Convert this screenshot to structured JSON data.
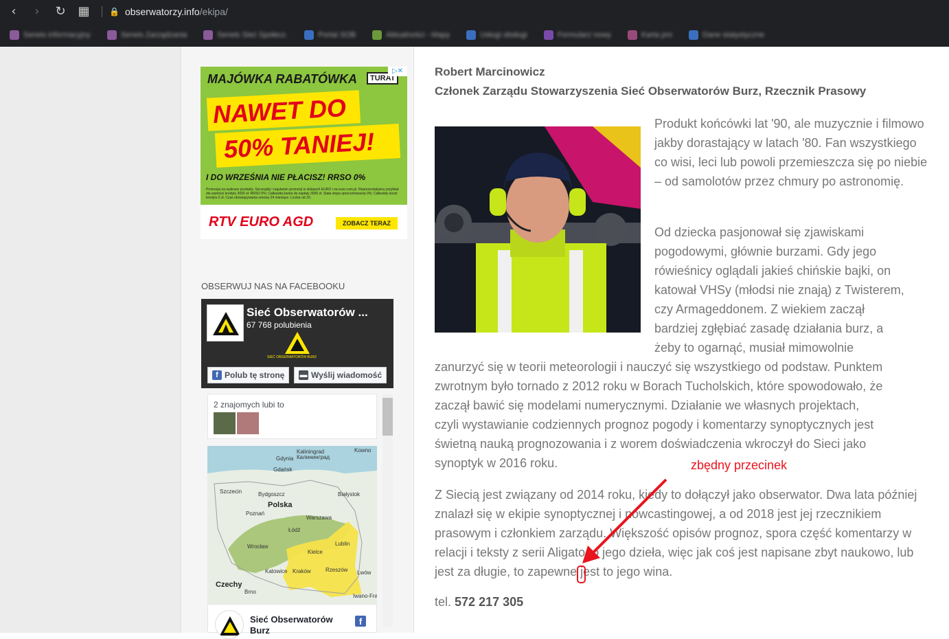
{
  "browser": {
    "url_host": "obserwatorzy.info",
    "url_path": "/ekipa/",
    "bookmarks": [
      "Serwis informacyjny",
      "Serwis Zarządzania",
      "Serwis Sieć Społecz.",
      "Portal SOB",
      "Aktualności - Mapy",
      "Usługi obsługi",
      "Formularz nowy",
      "Karta pro",
      "Dane statystyczne"
    ]
  },
  "ad": {
    "headline": "MAJÓWKA RABATÓWKA",
    "brand_tag": "TURAT",
    "big_line_1": "NAWET DO",
    "big_line_2": "50% TANIEJ!",
    "sub_line": "I DO WRZEŚNIA NIE PŁACISZ!  RRSO 0%",
    "fine_print": "Promocja na wybrane produkty. Szczegóły i regulamin promocji w sklepach EURO i na euro.com.pl. Reprezentatywny przykład dla wartości kredytu 3000 zł: RRSO 0%; Całkowita kwota do zapłaty 3000 zł. Stała stopa oprocentowania 0%; Całkowity koszt kredytu 0 zł. Czas obowiązywania umowy 24 miesiące. Liczba rat 20.",
    "logo_text": "RTV EURO AGD",
    "cta_label": "ZOBACZ TERAZ"
  },
  "facebook": {
    "heading": "OBSERWUJ NAS NA FACEBOOKU",
    "page_name": "Sieć Obserwatorów ...",
    "likes": "67 768 polubienia",
    "mini_logo_text": "SIEĆ OBSERWATORÓW BURZ",
    "like_button": "Polub tę stronę",
    "message_button": "Wyślij wiadomość",
    "friends_text": "2 znajomych lubi to",
    "post_title": "Sieć Obserwatorów Burz"
  },
  "map": {
    "labels": [
      "Gdynia",
      "Gdańsk",
      "Kaliningrad",
      "Калининград",
      "Kowno",
      "Szczecin",
      "Bydgoszcz",
      "Białystok",
      "Polska",
      "Poznań",
      "Warszawa",
      "Łódź",
      "Wrocław",
      "Lublin",
      "Kielce",
      "Kraków",
      "Katowice",
      "Rzeszów",
      "Lwów",
      "Czechy",
      "Brno",
      "Iwano-Frank"
    ]
  },
  "content": {
    "name": "Robert Marcinowicz",
    "role": "Członek Zarządu Stowarzyszenia Sieć Obserwatorów Burz, Rzecznik Prasowy",
    "para1": "Produkt końcówki lat '90, ale muzycznie i filmowo jakby dorastający w latach '80. Fan wszystkiego co wisi, leci lub powoli przemieszcza się po niebie – od samolotów przez chmury po astronomię.",
    "para2_lines_wrapped": [
      "Od dziecka pasjonował się zjawiskami",
      "pogodowymi, głównie burzami. Gdy jego",
      "rówieśnicy oglądali jakieś chińskie bajki, on",
      "katował VHSy (młodsi nie znają) z Twisterem,",
      "czy Armageddonem. Z wiekiem zaczął",
      "bardziej zgłębiać zasadę działania burz, a",
      "żeby to ogarnąć, musiał mimowolnie"
    ],
    "para2_lines_full": [
      "zanurzyć się w teorii meteorologii i nauczyć się wszystkiego od podstaw. Punktem",
      "zwrotnym było tornado z 2012 roku w Borach Tucholskich, które spowodowało, że",
      "zaczął bawić się modelami numerycznymi. Działanie we własnych projektach,",
      "czyli wystawianie codziennych prognoz pogody i komentarzy synoptycznych jest",
      "świetną nauką prognozowania i z worem doświadczenia wkroczył do Sieci jako",
      "synoptyk w 2016 roku."
    ],
    "para3": "Z Siecią jest związany od 2014 roku, kiedy to dołączył jako obserwator. Dwa lata później znalazł się w ekipie synoptycznej i nowcastingowej, a od 2018 jest jej rzecznikiem prasowym i członkiem zarządu. Większość opisów prognoz, spora część komentarzy w relacji i teksty z serii Aligato to jego dzieła, więc jak coś jest napisane zbyt naukowo, lub jest za długie, to zapewne jest to jego wina.",
    "phone_label": "tel.",
    "phone_number": "572 217 305"
  },
  "annotation": {
    "text": "zbędny przecinek",
    "color": "#e8141e"
  },
  "colors": {
    "chrome_bg": "#202124",
    "sidebar_bg": "#f5f5f5",
    "ad_green": "#8dc63f",
    "ad_yellow": "#ffe600",
    "ad_red": "#e2001a",
    "fb_blue": "#4267b2"
  }
}
